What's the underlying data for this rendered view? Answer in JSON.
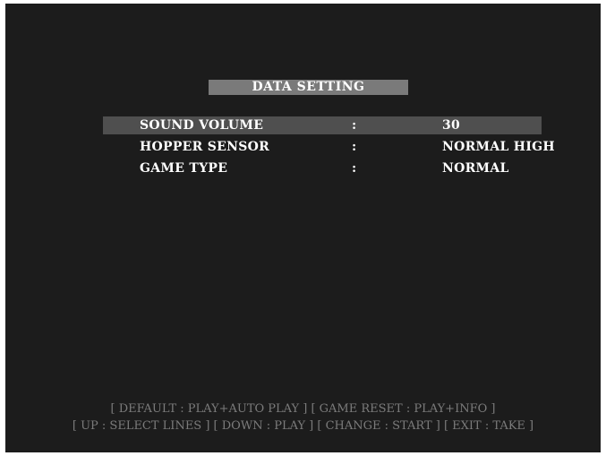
{
  "screen": {
    "title": "DATA SETTING"
  },
  "settings": [
    {
      "label": "SOUND VOLUME",
      "separator": ":",
      "value": "30",
      "selected": true
    },
    {
      "label": "HOPPER SENSOR",
      "separator": ":",
      "value": "NORMAL HIGH",
      "selected": false
    },
    {
      "label": "GAME TYPE",
      "separator": ":",
      "value": "NORMAL",
      "selected": false
    }
  ],
  "help": {
    "line1": "[ DEFAULT : PLAY+AUTO PLAY ]   [ GAME RESET : PLAY+INFO ]",
    "line2": "[ UP : SELECT LINES ] [ DOWN : PLAY ] [ CHANGE : START ] [ EXIT : TAKE ]"
  },
  "colors": {
    "background": "#1c1c1c",
    "title_bar": "#7a7a7a",
    "selected_row": "#4f4f4f",
    "text": "#ffffff",
    "help_text": "#7b7b7b"
  }
}
